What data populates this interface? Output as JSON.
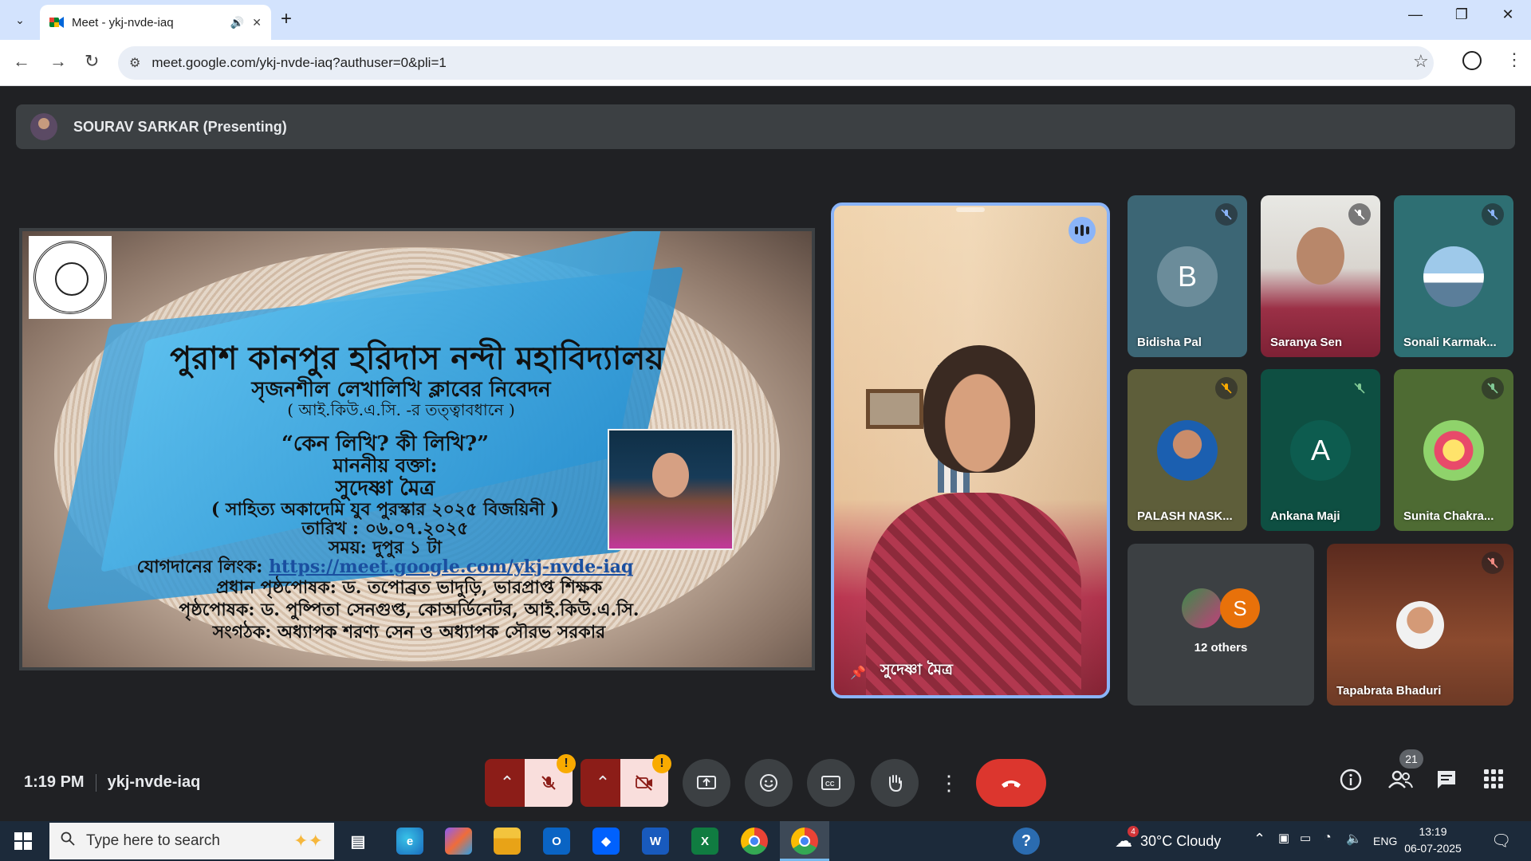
{
  "browser": {
    "tab_title": "Meet - ykj-nvde-iaq",
    "url": "meet.google.com/ykj-nvde-iaq?authuser=0&pli=1"
  },
  "meet": {
    "presenter_bar": "SOURAV SARKAR (Presenting)",
    "slide": {
      "college": "পুরাশ কানপুর হরিদাস নন্দী মহাবিদ্যালয়",
      "club": "সৃজনশীল লেখালিখি ক্লাবের নিবেদন",
      "supervision": "( আই.কিউ.এ.সি. -র তত্ত্বাবধানে )",
      "topic": "“কেন লিখি? কী লিখি?”",
      "speaker_label": "মাননীয় বক্তা:",
      "speaker": "সুদেষ্ণা মৈত্র",
      "award": "( সাহিত্য অকাদেমি যুব পুরস্কার ২০২৫ বিজয়িনী )",
      "date": "তারিখ : ০৬.০৭.২০২৫",
      "time": "সময়: দুপুর ১ টা",
      "link_label": "যোগদানের লিংক:",
      "link": "https://meet.google.com/ykj-nvde-iaq",
      "patron": "প্রধান পৃষ্ঠপোষক: ড. তপোব্রত ভাদুড়ি, ভারপ্রাপ্ত শিক্ষক",
      "sponsor": "পৃষ্ঠপোষক: ড. পুষ্পিতা সেনগুপ্ত, কোঅর্ডিনেটর, আই.কিউ.এ.সি.",
      "organizers": "সংগঠক: অধ্যাপক শরণ্য সেন ও অধ্যাপক সৌরভ সরকার"
    },
    "featured_name": "সুদেষ্ণা মৈত্র",
    "tiles": [
      {
        "name": "Bidisha Pal",
        "letter": "B",
        "color": "#6b8c9a"
      },
      {
        "name": "Saranya Sen"
      },
      {
        "name": "Sonali Karmak..."
      },
      {
        "name": "PALASH NASK..."
      },
      {
        "name": "Ankana Maji",
        "letter": "A",
        "color": "#0d5c4f"
      },
      {
        "name": "Sunita Chakra..."
      },
      {
        "name": "12 others",
        "letter": "S"
      },
      {
        "name": "Tapabrata Bhaduri"
      }
    ],
    "time": "1:19 PM",
    "meeting_code": "ykj-nvde-iaq",
    "participants_count": "21"
  },
  "taskbar": {
    "search_placeholder": "Type here to search",
    "weather": "30°C  Cloudy",
    "weather_badge": "4",
    "lang": "ENG",
    "time": "13:19",
    "date": "06-07-2025"
  },
  "colors": {
    "meet_bg": "#202124",
    "featured_border": "#8ab4f8",
    "end_call": "#dc362e",
    "mic_muted_bg": "#f9dedc",
    "warning": "#f9ab00"
  }
}
